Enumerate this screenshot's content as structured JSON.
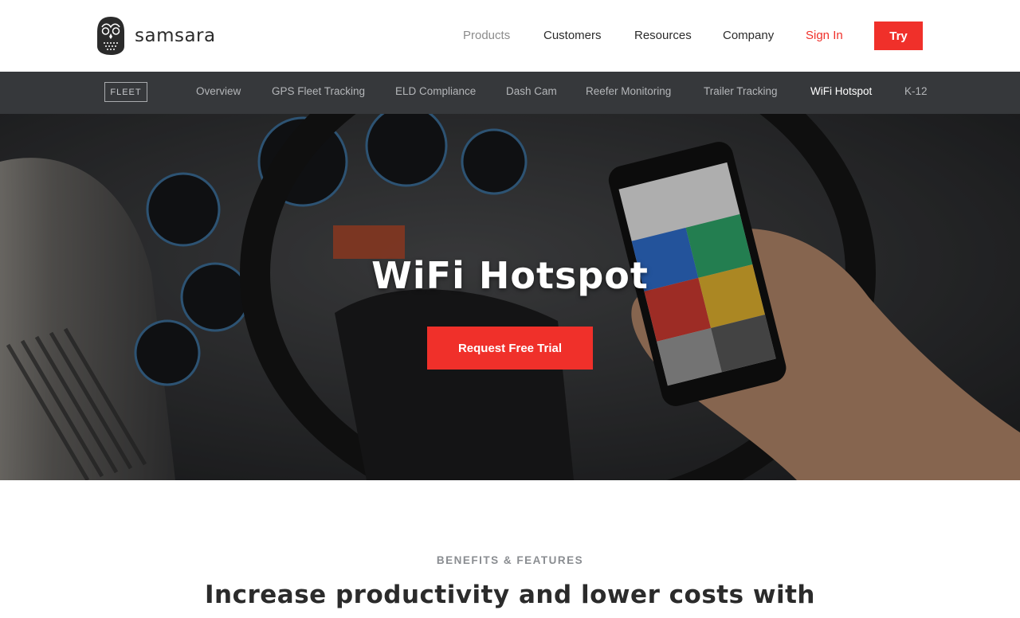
{
  "header": {
    "logo_text": "samsara",
    "nav": [
      {
        "label": "Products",
        "color": "#8c8c8c"
      },
      {
        "label": "Customers",
        "color": "#2b2b2b"
      },
      {
        "label": "Resources",
        "color": "#2b2b2b"
      },
      {
        "label": "Company",
        "color": "#2b2b2b"
      },
      {
        "label": "Sign In",
        "color": "#f0302a"
      }
    ],
    "try_label": "Try"
  },
  "subnav": {
    "section_tag": "FLEET",
    "items": [
      {
        "label": "Overview"
      },
      {
        "label": "GPS Fleet Tracking"
      },
      {
        "label": "ELD Compliance"
      },
      {
        "label": "Dash Cam"
      },
      {
        "label": "Reefer Monitoring"
      },
      {
        "label": "Trailer Tracking"
      },
      {
        "label": "WiFi Hotspot",
        "active": true
      },
      {
        "label": "K-12"
      }
    ]
  },
  "hero": {
    "title": "WiFi Hotspot",
    "cta_label": "Request Free Trial"
  },
  "benefits": {
    "eyebrow": "BENEFITS & FEATURES",
    "title": "Increase productivity and lower costs with"
  },
  "colors": {
    "accent": "#f0302a",
    "subnav_bg": "#36383b"
  }
}
